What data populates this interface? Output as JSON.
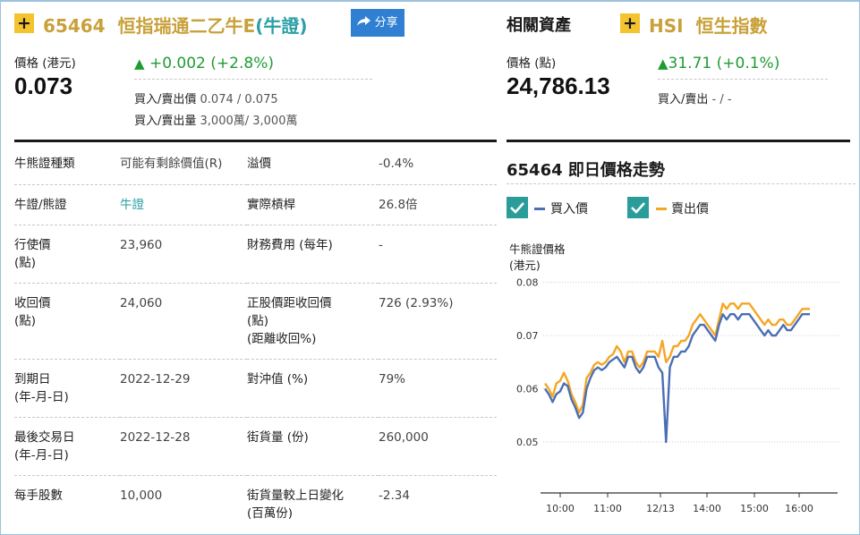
{
  "warrant": {
    "code": "65464",
    "name": "恒指瑞通二乙牛E",
    "type_tag": "(牛證)",
    "share_label": "分享",
    "price_label": "價格 (港元)",
    "price": "0.073",
    "change": "+0.002",
    "change_pct": "(+2.8%)",
    "bid_ask_label": "買入/賣出價",
    "bid_ask": "0.074 / 0.075",
    "bid_ask_vol_label": "買入/賣出量",
    "bid_ask_vol": "3,000萬/ 3,000萬"
  },
  "underlying": {
    "section_label": "相關資產",
    "code": "HSI",
    "name": "恒生指數",
    "price_label": "價格 (點)",
    "price": "24,786.13",
    "change": "31.71",
    "change_pct": "(+0.1%)",
    "bid_ask_label": "買入/賣出",
    "bid_ask": "- / -"
  },
  "details": [
    {
      "k1": "牛熊證種類",
      "v1": "可能有剩餘價值(R)",
      "k2": "溢價",
      "v2": "-0.4%"
    },
    {
      "k1": "牛證/熊證",
      "v1": "牛證",
      "k2": "實際槓桿",
      "v2": "26.8倍"
    },
    {
      "k1": "行使價",
      "k1b": "(點)",
      "v1": "23,960",
      "k2": "財務費用 (每年)",
      "v2": "-"
    },
    {
      "k1": "收回價",
      "k1b": "(點)",
      "v1": "24,060",
      "k2": "正股價距收回價",
      "k2b": "(點)",
      "k2c": "(距離收回%)",
      "v2": "726 (2.93%)"
    },
    {
      "k1": "到期日",
      "k1b": "(年-月-日)",
      "v1": "2022-12-29",
      "k2": "對沖值 (%)",
      "v2": "79%"
    },
    {
      "k1": "最後交易日",
      "k1b": "(年-月-日)",
      "v1": "2022-12-28",
      "k2": "街貨量 (份)",
      "v2": "260,000"
    },
    {
      "k1": "每手股數",
      "v1": "10,000",
      "k2": "街貨量較上日變化",
      "k2b": "(百萬份)",
      "v2": "-2.34"
    }
  ],
  "chart_section": {
    "title": "65464 即日價格走勢",
    "legend_bid": "買入價",
    "legend_ask": "賣出價"
  },
  "chart_data": {
    "type": "line",
    "ylabel_line1": "牛熊證價格",
    "ylabel_line2": "(港元)",
    "ylim": [
      0.045,
      0.082
    ],
    "y_ticks": [
      "0.08",
      "0.07",
      "0.06",
      "0.05"
    ],
    "y_tick_values": [
      0.08,
      0.07,
      0.06,
      0.05
    ],
    "x_tick_labels": [
      "10:00",
      "11:00",
      "12/13",
      "14:00",
      "15:00",
      "16:00"
    ],
    "grid": "horizontal-dotted",
    "series": [
      {
        "name": "買入價",
        "color": "#4a6fb5",
        "values": [
          0.06,
          0.059,
          0.0575,
          0.059,
          0.0595,
          0.061,
          0.0605,
          0.058,
          0.0565,
          0.0545,
          0.0555,
          0.06,
          0.062,
          0.0635,
          0.064,
          0.0635,
          0.064,
          0.065,
          0.0655,
          0.066,
          0.065,
          0.064,
          0.066,
          0.066,
          0.064,
          0.063,
          0.064,
          0.066,
          0.066,
          0.066,
          0.064,
          0.063,
          0.05,
          0.064,
          0.066,
          0.066,
          0.067,
          0.067,
          0.068,
          0.07,
          0.071,
          0.072,
          0.072,
          0.071,
          0.07,
          0.069,
          0.072,
          0.074,
          0.073,
          0.074,
          0.074,
          0.073,
          0.074,
          0.074,
          0.074,
          0.073,
          0.072,
          0.071,
          0.07,
          0.071,
          0.07,
          0.07,
          0.071,
          0.072,
          0.071,
          0.071,
          0.072,
          0.073,
          0.074,
          0.074,
          0.074
        ]
      },
      {
        "name": "賣出價",
        "color": "#f5a623",
        "values": [
          0.061,
          0.06,
          0.0585,
          0.061,
          0.0615,
          0.063,
          0.0615,
          0.059,
          0.0575,
          0.0555,
          0.057,
          0.062,
          0.063,
          0.0645,
          0.065,
          0.0645,
          0.065,
          0.066,
          0.0665,
          0.068,
          0.067,
          0.065,
          0.067,
          0.067,
          0.065,
          0.064,
          0.065,
          0.067,
          0.067,
          0.067,
          0.066,
          0.069,
          0.065,
          0.066,
          0.068,
          0.068,
          0.069,
          0.069,
          0.07,
          0.072,
          0.073,
          0.074,
          0.073,
          0.072,
          0.071,
          0.07,
          0.073,
          0.076,
          0.075,
          0.076,
          0.076,
          0.075,
          0.076,
          0.076,
          0.076,
          0.075,
          0.074,
          0.073,
          0.072,
          0.073,
          0.072,
          0.072,
          0.073,
          0.073,
          0.072,
          0.072,
          0.073,
          0.074,
          0.075,
          0.075,
          0.075
        ]
      }
    ]
  }
}
